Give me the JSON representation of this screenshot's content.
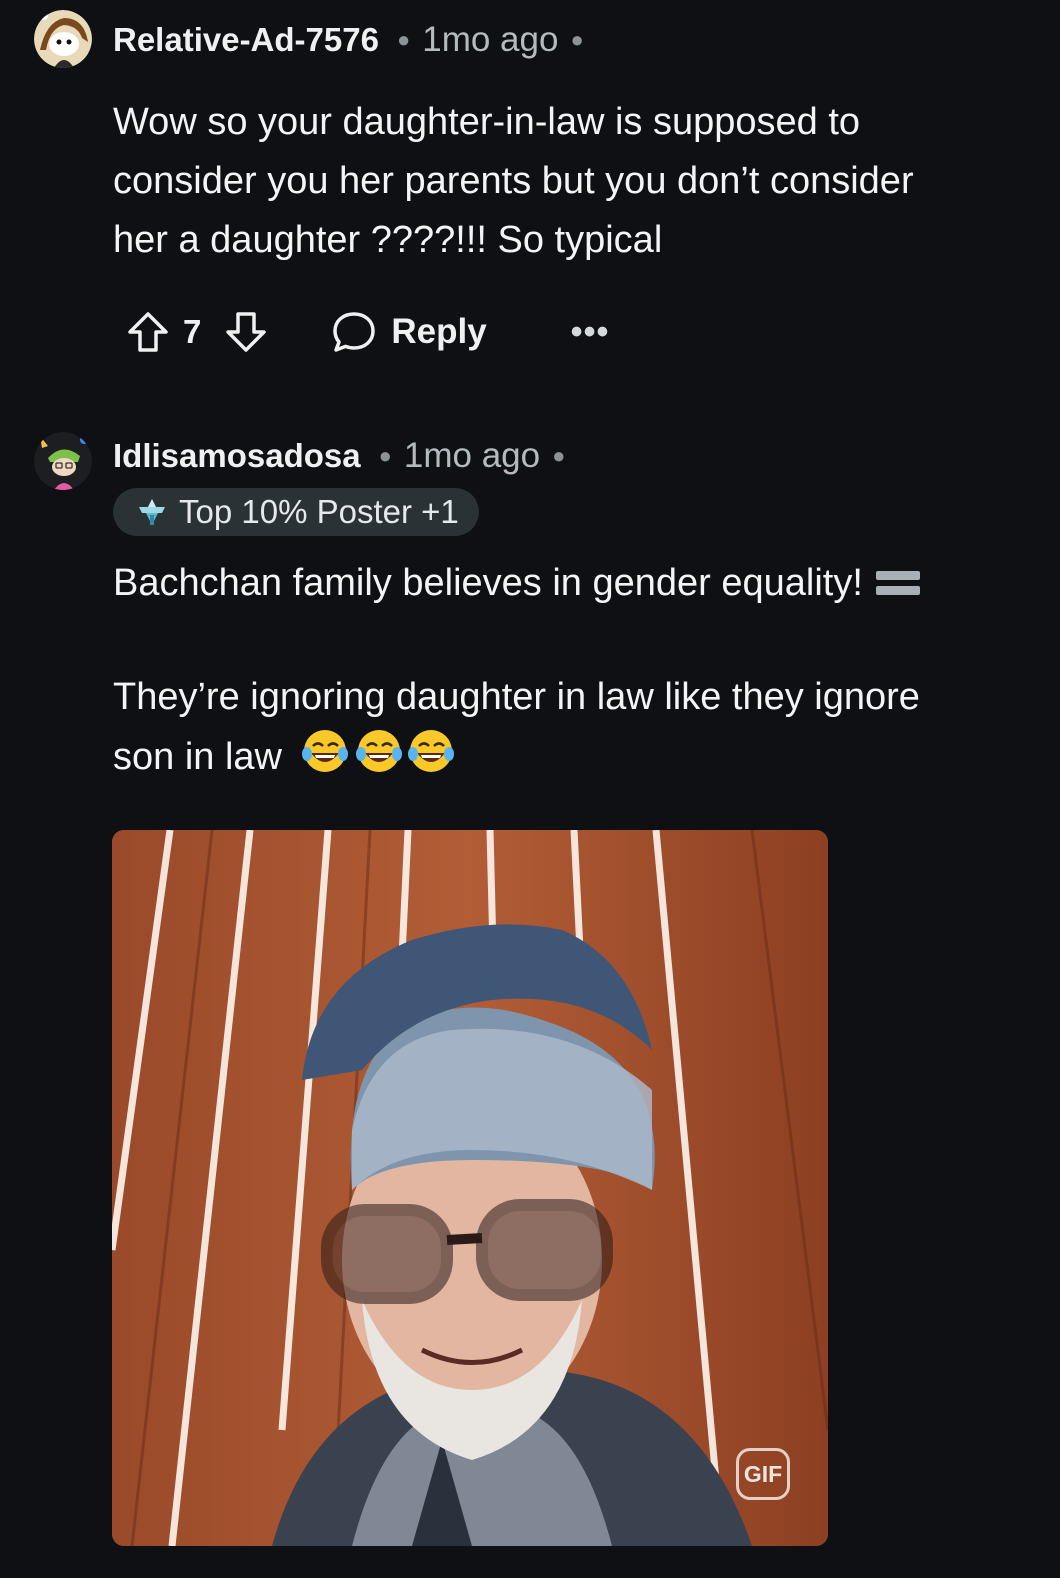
{
  "comments": [
    {
      "username": "Relative-Ad-7576",
      "time": "1mo ago",
      "body_lines": [
        "Wow so your daughter-in-law is supposed to",
        "consider you her parents but you don’t consider",
        "her a daughter ????!!! So typical"
      ],
      "vote_count": "7",
      "reply_label": "Reply",
      "more_label": "•••",
      "icons": [
        "upvote-icon",
        "downvote-icon",
        "comment-bubble-icon",
        "more-icon"
      ]
    },
    {
      "username": "Idlisamosadosa",
      "time": "1mo ago",
      "badge": "Top 10% Poster +1",
      "paragraph1": "Bachchan family believes in gender equality!",
      "paragraph2_line1": "They’re ignoring daughter in law like they ignore",
      "paragraph2_line2": "son in law",
      "gif_label": "GIF",
      "icons": [
        "equals-emoji-icon",
        "tears-of-joy-emoji-icon",
        "trophy-badge-icon"
      ]
    }
  ],
  "colors": {
    "background": "#0e1013",
    "text": "#f2f4f5",
    "meta": "#b4bbbf",
    "badge_bg": "#2b3236"
  }
}
